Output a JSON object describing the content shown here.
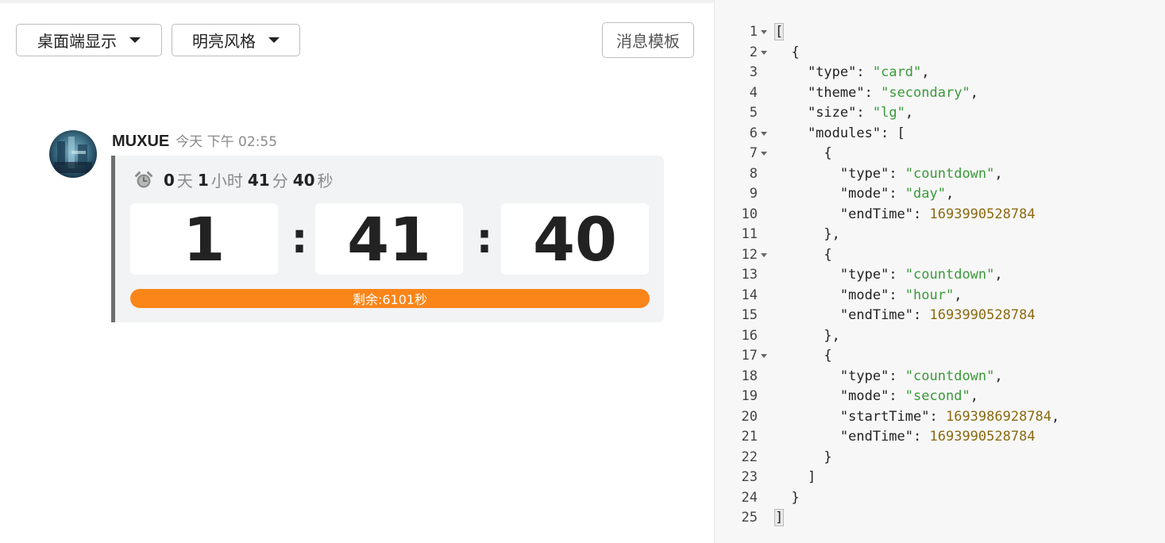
{
  "toolbar": {
    "platform_label": "桌面端显示",
    "theme_label": "明亮风格",
    "template_label": "消息模板"
  },
  "message": {
    "sender": "MUXUE",
    "time": "今天 下午 02:55"
  },
  "countdown": {
    "days": "0",
    "days_unit": "天",
    "hours": "1",
    "hours_unit": "小时",
    "minutes": "41",
    "minutes_unit": "分",
    "seconds": "40",
    "seconds_unit": "秒",
    "hour_box": "1",
    "minute_box": "41",
    "second_box": "40",
    "separator": ":",
    "progress_label": "剩余:6101秒",
    "progress_fraction": 1.0
  },
  "colors": {
    "progress": "#fa8519",
    "card_border": "#6f6f6f",
    "json_string": "#3a9a3a",
    "json_number": "#8a6a10"
  },
  "editor": {
    "lines": [
      {
        "n": "1",
        "fold": true,
        "code": "[",
        "type": "open"
      },
      {
        "n": "2",
        "fold": true,
        "code": "  {",
        "type": "plain"
      },
      {
        "n": "3",
        "fold": false,
        "key": "\"type\"",
        "sep": ": ",
        "val": "\"card\"",
        "vtype": "str",
        "tail": ",",
        "indent": "    "
      },
      {
        "n": "4",
        "fold": false,
        "key": "\"theme\"",
        "sep": ": ",
        "val": "\"secondary\"",
        "vtype": "str",
        "tail": ",",
        "indent": "    "
      },
      {
        "n": "5",
        "fold": false,
        "key": "\"size\"",
        "sep": ": ",
        "val": "\"lg\"",
        "vtype": "str",
        "tail": ",",
        "indent": "    "
      },
      {
        "n": "6",
        "fold": true,
        "code": "    \"modules\": [",
        "type": "plain"
      },
      {
        "n": "7",
        "fold": true,
        "code": "      {",
        "type": "plain"
      },
      {
        "n": "8",
        "fold": false,
        "key": "\"type\"",
        "sep": ": ",
        "val": "\"countdown\"",
        "vtype": "str",
        "tail": ",",
        "indent": "        "
      },
      {
        "n": "9",
        "fold": false,
        "key": "\"mode\"",
        "sep": ": ",
        "val": "\"day\"",
        "vtype": "str",
        "tail": ",",
        "indent": "        "
      },
      {
        "n": "10",
        "fold": false,
        "key": "\"endTime\"",
        "sep": ": ",
        "val": "1693990528784",
        "vtype": "num",
        "tail": "",
        "indent": "        "
      },
      {
        "n": "11",
        "fold": false,
        "code": "      },",
        "type": "plain"
      },
      {
        "n": "12",
        "fold": true,
        "code": "      {",
        "type": "plain"
      },
      {
        "n": "13",
        "fold": false,
        "key": "\"type\"",
        "sep": ": ",
        "val": "\"countdown\"",
        "vtype": "str",
        "tail": ",",
        "indent": "        "
      },
      {
        "n": "14",
        "fold": false,
        "key": "\"mode\"",
        "sep": ": ",
        "val": "\"hour\"",
        "vtype": "str",
        "tail": ",",
        "indent": "        "
      },
      {
        "n": "15",
        "fold": false,
        "key": "\"endTime\"",
        "sep": ": ",
        "val": "1693990528784",
        "vtype": "num",
        "tail": "",
        "indent": "        "
      },
      {
        "n": "16",
        "fold": false,
        "code": "      },",
        "type": "plain"
      },
      {
        "n": "17",
        "fold": true,
        "code": "      {",
        "type": "plain"
      },
      {
        "n": "18",
        "fold": false,
        "key": "\"type\"",
        "sep": ": ",
        "val": "\"countdown\"",
        "vtype": "str",
        "tail": ",",
        "indent": "        "
      },
      {
        "n": "19",
        "fold": false,
        "key": "\"mode\"",
        "sep": ": ",
        "val": "\"second\"",
        "vtype": "str",
        "tail": ",",
        "indent": "        "
      },
      {
        "n": "20",
        "fold": false,
        "key": "\"startTime\"",
        "sep": ": ",
        "val": "1693986928784",
        "vtype": "num",
        "tail": ",",
        "indent": "        "
      },
      {
        "n": "21",
        "fold": false,
        "key": "\"endTime\"",
        "sep": ": ",
        "val": "1693990528784",
        "vtype": "num",
        "tail": "",
        "indent": "        "
      },
      {
        "n": "22",
        "fold": false,
        "code": "      }",
        "type": "plain"
      },
      {
        "n": "23",
        "fold": false,
        "code": "    ]",
        "type": "plain"
      },
      {
        "n": "24",
        "fold": false,
        "code": "  }",
        "type": "plain"
      },
      {
        "n": "25",
        "fold": false,
        "code": "]",
        "type": "close"
      }
    ]
  }
}
